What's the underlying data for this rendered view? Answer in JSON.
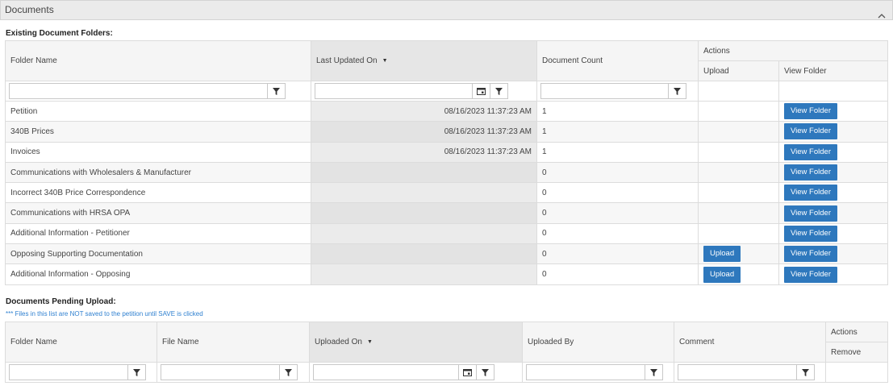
{
  "panel": {
    "title": "Documents"
  },
  "existing": {
    "title": "Existing Document Folders:",
    "headers": {
      "folder_name": "Folder Name",
      "last_updated": "Last Updated On",
      "document_count": "Document Count",
      "actions": "Actions",
      "upload": "Upload",
      "view_folder": "View Folder"
    },
    "rows": [
      {
        "folder": "Petition",
        "updated": "08/16/2023 11:37:23 AM",
        "count": "1",
        "upload": "",
        "view": "View Folder"
      },
      {
        "folder": "340B Prices",
        "updated": "08/16/2023 11:37:23 AM",
        "count": "1",
        "upload": "",
        "view": "View Folder"
      },
      {
        "folder": "Invoices",
        "updated": "08/16/2023 11:37:23 AM",
        "count": "1",
        "upload": "",
        "view": "View Folder"
      },
      {
        "folder": "Communications with Wholesalers & Manufacturer",
        "updated": "",
        "count": "0",
        "upload": "",
        "view": "View Folder"
      },
      {
        "folder": "Incorrect 340B Price Correspondence",
        "updated": "",
        "count": "0",
        "upload": "",
        "view": "View Folder"
      },
      {
        "folder": "Communications with HRSA OPA",
        "updated": "",
        "count": "0",
        "upload": "",
        "view": "View Folder"
      },
      {
        "folder": "Additional Information - Petitioner",
        "updated": "",
        "count": "0",
        "upload": "",
        "view": "View Folder"
      },
      {
        "folder": "Opposing Supporting Documentation",
        "updated": "",
        "count": "0",
        "upload": "Upload",
        "view": "View Folder"
      },
      {
        "folder": "Additional Information - Opposing",
        "updated": "",
        "count": "0",
        "upload": "Upload",
        "view": "View Folder"
      }
    ]
  },
  "pending": {
    "title": "Documents Pending Upload:",
    "note": "*** Files in this list are NOT saved to the petition until SAVE is clicked",
    "headers": {
      "folder_name": "Folder Name",
      "file_name": "File Name",
      "uploaded_on": "Uploaded On",
      "uploaded_by": "Uploaded By",
      "comment": "Comment",
      "actions": "Actions",
      "remove": "Remove"
    }
  },
  "icons": {
    "filter": "filter-icon",
    "calendar": "calendar-icon",
    "sort": "sort-down-icon",
    "collapse": "chevron-up-icon"
  },
  "colors": {
    "primary_button": "#2e78bd",
    "note_text": "#2f80d0"
  }
}
